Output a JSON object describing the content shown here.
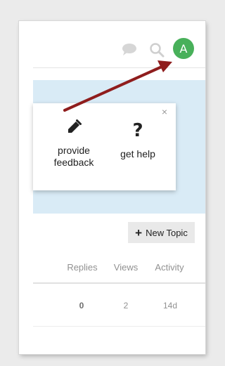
{
  "header": {
    "chat_icon": "chat-bubble-icon",
    "search_icon": "search-icon",
    "avatar_letter": "A",
    "avatar_color": "#48b05a"
  },
  "popup": {
    "close_label": "×",
    "options": [
      {
        "label": "provide feedback",
        "icon": "pencil-icon"
      },
      {
        "label": "get help",
        "icon": "question-icon"
      }
    ]
  },
  "toolbar": {
    "new_topic_label": "New Topic",
    "new_topic_icon": "+"
  },
  "table": {
    "headers": [
      "Replies",
      "Views",
      "Activity"
    ],
    "rows": [
      {
        "replies": "0",
        "views": "2",
        "activity": "14d"
      }
    ]
  },
  "colors": {
    "banner": "#d9ebf6",
    "annotation_arrow": "#8f1d1d",
    "muted_text": "#919191"
  }
}
